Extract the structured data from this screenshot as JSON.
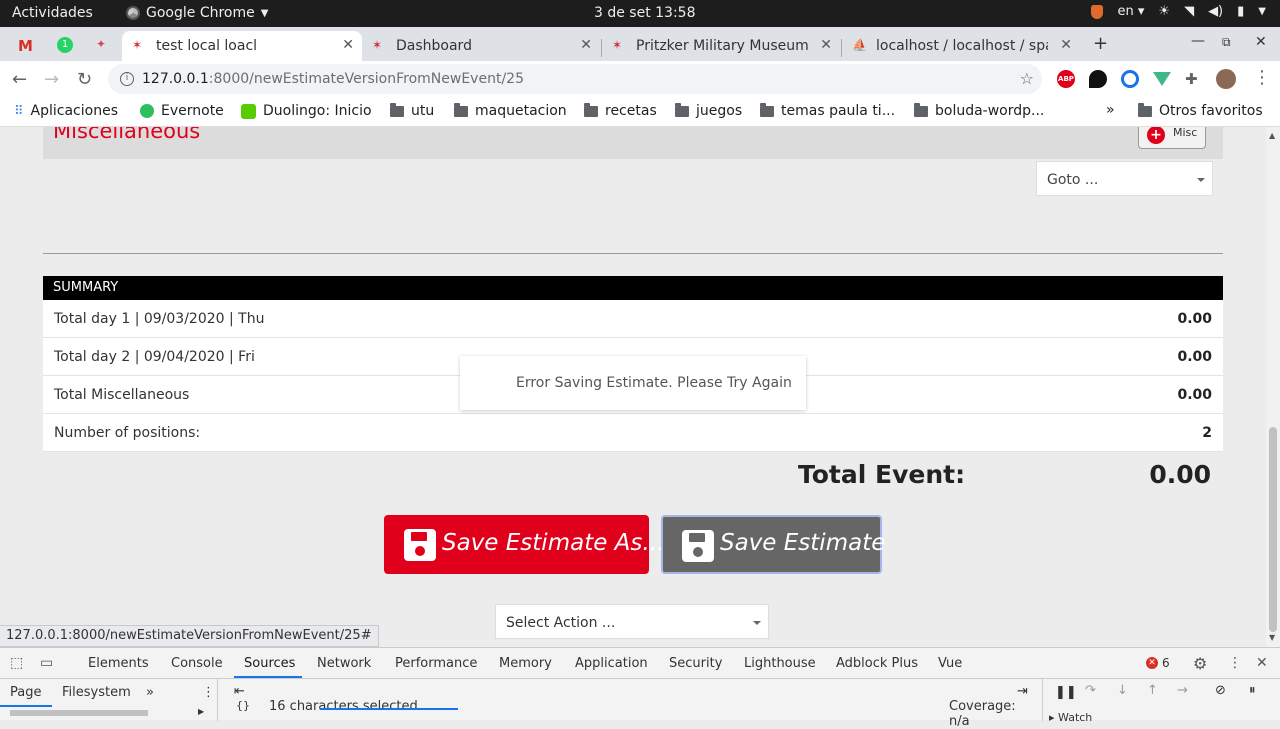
{
  "os": {
    "activities": "Actividades",
    "app_name": "Google Chrome",
    "clock": "3 de set  13:58",
    "lang": "en"
  },
  "tabs": [
    {
      "title": "test local loacl",
      "active": true
    },
    {
      "title": "Dashboard",
      "active": false
    },
    {
      "title": "Pritzker Military Museum",
      "active": false
    },
    {
      "title": "localhost / localhost / spa",
      "active": false
    }
  ],
  "address_bar": {
    "host": "127.0.0.1",
    "path": ":8000/newEstimateVersionFromNewEvent/25"
  },
  "bookmarks": {
    "apps": "Aplicaciones",
    "items": [
      "Evernote",
      "Duolingo: Inicio",
      "utu",
      "maquetacion",
      "recetas",
      "juegos",
      "temas paula ti...",
      "boluda-wordp..."
    ],
    "overflow": "»",
    "other": "Otros favoritos"
  },
  "misc_section": {
    "title": "Miscellaneous",
    "add_button": "Misc",
    "goto_placeholder": "Goto ..."
  },
  "summary": {
    "header": "SUMMARY",
    "rows": [
      {
        "label": "Total day 1 | 09/03/2020 | Thu",
        "value": "0.00"
      },
      {
        "label": "Total day 2 | 09/04/2020 | Fri",
        "value": "0.00"
      },
      {
        "label": "Total Miscellaneous",
        "value": "0.00"
      },
      {
        "label": "Number of positions:",
        "value": "2"
      }
    ],
    "total_label": "Total Event:",
    "total_value": "0.00"
  },
  "toast": "Error Saving Estimate. Please Try Again",
  "actions": {
    "save_as": "Save Estimate As...",
    "save": "Save Estimate",
    "select_action": "Select Action ..."
  },
  "status_url": "127.0.0.1:8000/newEstimateVersionFromNewEvent/25#",
  "devtools": {
    "tabs": [
      "Elements",
      "Console",
      "Sources",
      "Network",
      "Performance",
      "Memory",
      "Application",
      "Security",
      "Lighthouse",
      "Adblock Plus",
      "Vue"
    ],
    "active_tab": "Sources",
    "error_count": "6",
    "nav_tabs": [
      "Page",
      "Filesystem"
    ],
    "overflow": "»",
    "selection_status": "16 characters selected",
    "coverage": "Coverage: n/a",
    "watch": "Watch"
  },
  "colors": {
    "brand_red": "#e0001b",
    "save_grey": "#666666",
    "devtools_accent": "#1a73e8"
  }
}
